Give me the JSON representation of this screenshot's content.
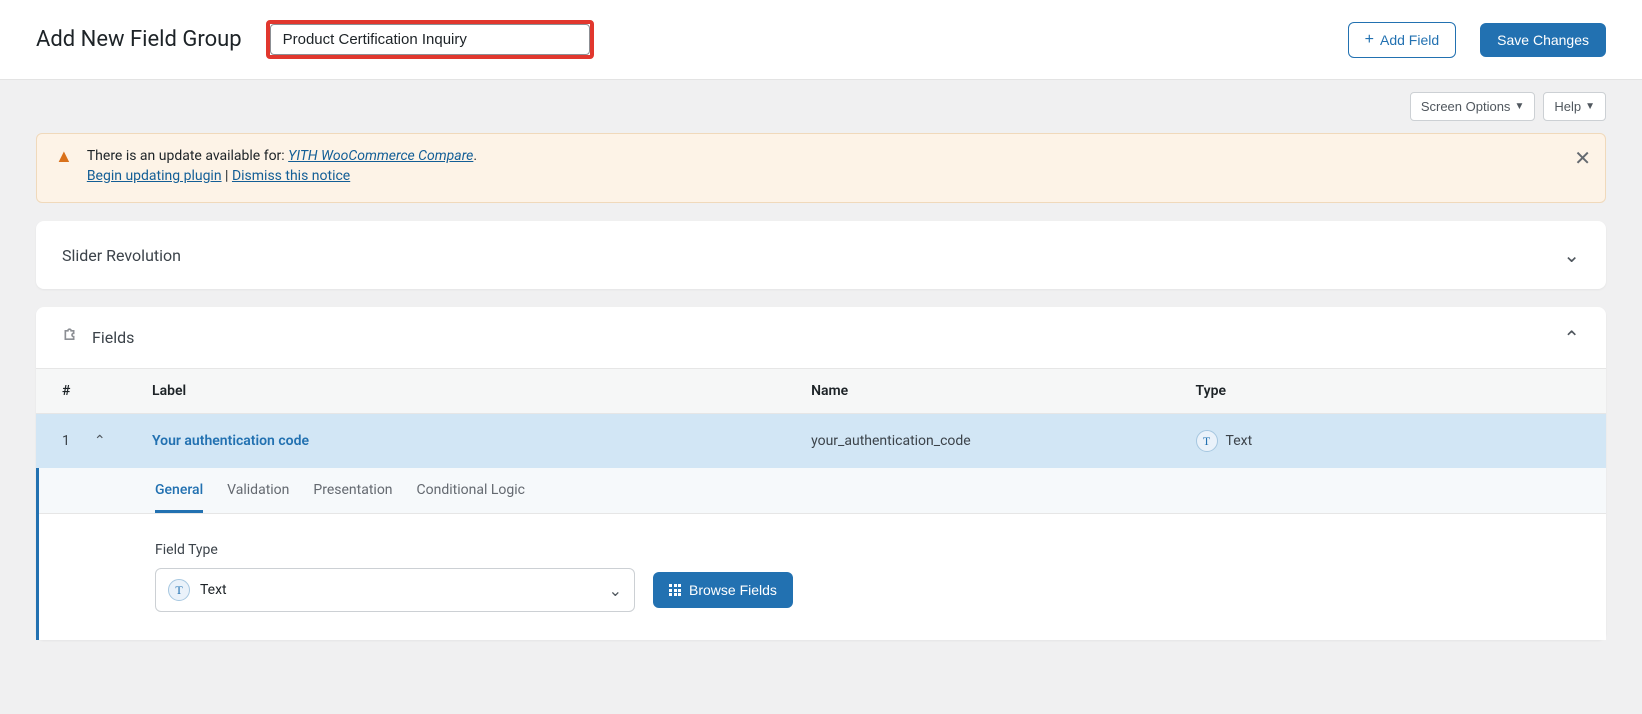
{
  "header": {
    "page_title": "Add New Field Group",
    "title_value": "Product Certification Inquiry",
    "add_field": "Add Field",
    "save_changes": "Save Changes"
  },
  "secondary": {
    "screen_options": "Screen Options",
    "help": "Help"
  },
  "notice": {
    "text_before": "There is an update available for: ",
    "plugin_name": "YITH WooCommerce Compare",
    "period": ".",
    "begin_link": "Begin updating plugin",
    "sep": " | ",
    "dismiss_link": "Dismiss this notice"
  },
  "slider_panel": {
    "title": "Slider Revolution"
  },
  "fields_panel": {
    "title": "Fields",
    "columns": {
      "num": "#",
      "label": "Label",
      "name": "Name",
      "type": "Type"
    },
    "row": {
      "index": "1",
      "label": "Your authentication code",
      "name": "your_authentication_code",
      "type_label": "Text",
      "type_glyph": "T"
    },
    "tabs": {
      "general": "General",
      "validation": "Validation",
      "presentation": "Presentation",
      "conditional": "Conditional Logic"
    },
    "editor": {
      "field_type_label": "Field Type",
      "selected_type": "Text",
      "selected_glyph": "T",
      "browse_button": "Browse Fields"
    }
  }
}
